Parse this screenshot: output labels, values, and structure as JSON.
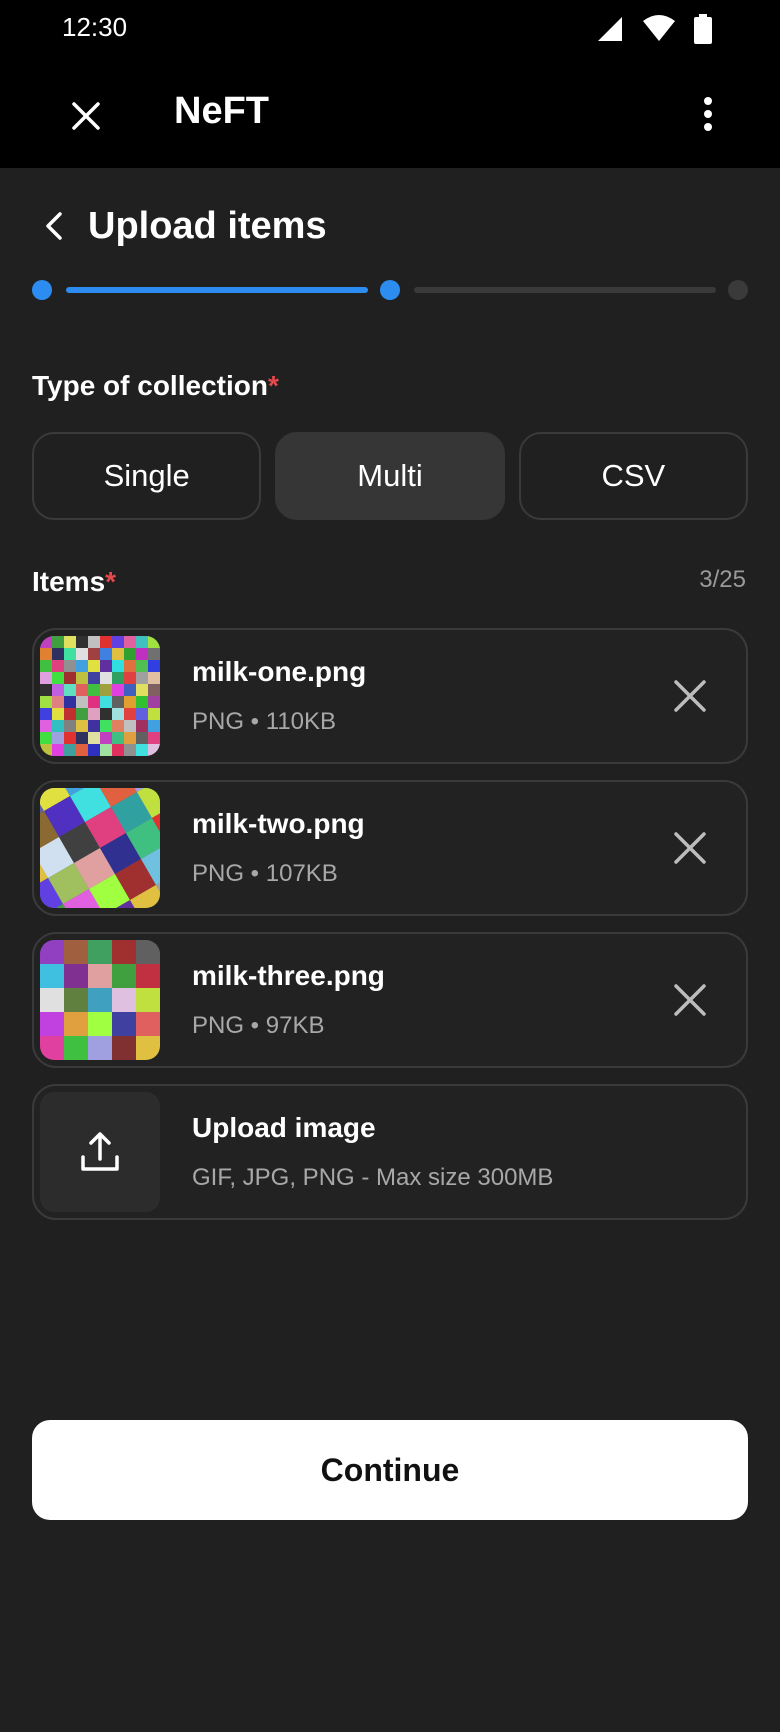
{
  "status_bar": {
    "time": "12:30"
  },
  "app_bar": {
    "title": "NeFT"
  },
  "page": {
    "title": "Upload items"
  },
  "stepper": {
    "current_step": 2,
    "total_steps": 3,
    "colors": {
      "active": "#2d8cf0",
      "inactive": "#3a3a3a"
    }
  },
  "collection_type": {
    "label": "Type of collection",
    "required_mark": "*",
    "options": [
      "Single",
      "Multi",
      "CSV"
    ],
    "selected": "Multi"
  },
  "items": {
    "label": "Items",
    "required_mark": "*",
    "count": "3/25",
    "list": [
      {
        "name": "milk-one.png",
        "meta": "PNG • 110KB"
      },
      {
        "name": "milk-two.png",
        "meta": "PNG • 107KB"
      },
      {
        "name": "milk-three.png",
        "meta": "PNG • 97KB"
      }
    ]
  },
  "upload": {
    "title": "Upload image",
    "hint": "GIF, JPG, PNG - Max size 300MB"
  },
  "continue": {
    "label": "Continue"
  },
  "icons": [
    "signal-icon",
    "wifi-icon",
    "battery-icon",
    "close-icon",
    "more-vertical-icon",
    "chevron-left-icon",
    "remove-icon",
    "upload-icon"
  ]
}
